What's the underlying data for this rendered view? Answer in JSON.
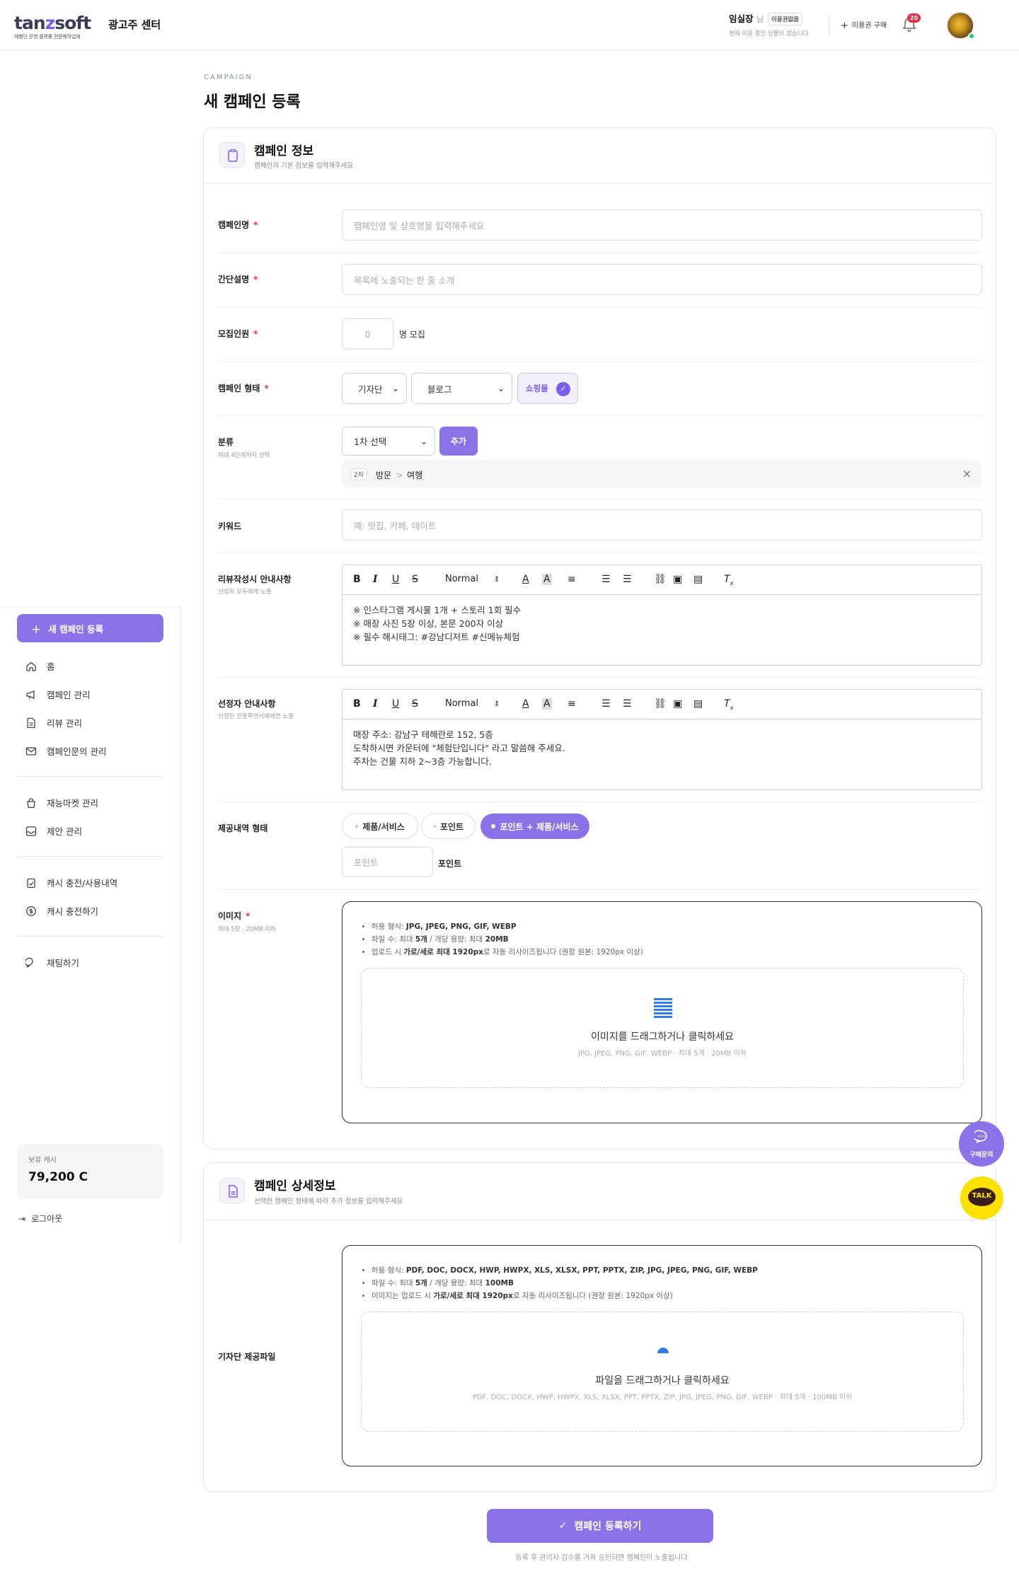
{
  "header": {
    "logo_a": "tan",
    "logo_b": "z",
    "logo_c": "soft",
    "logo_tagline": "체험단 운영 플랫폼 전문제작업체",
    "site_title": "광고주 센터",
    "user_name": "임실장",
    "user_suffix": "님",
    "user_badge": "이용권없음",
    "user_sub": "현재 이용 중인 상품이 없습니다.",
    "buy_label": "이용권 구매",
    "notif_count": "20"
  },
  "sidebar": {
    "new_campaign": "새 캠페인 등록",
    "items": [
      {
        "label": "홈",
        "icon": "home-icon"
      },
      {
        "label": "캠페인 관리",
        "icon": "megaphone-icon"
      },
      {
        "label": "리뷰 관리",
        "icon": "document-icon"
      },
      {
        "label": "캠페인문의 관리",
        "icon": "mail-icon"
      },
      {
        "label": "재능마켓 관리",
        "icon": "bag-icon"
      },
      {
        "label": "제안 관리",
        "icon": "inbox-icon"
      },
      {
        "label": "캐시 충전/사용내역",
        "icon": "clipboard-check-icon"
      },
      {
        "label": "캐시 충전하기",
        "icon": "dollar-icon"
      },
      {
        "label": "채팅하기",
        "icon": "chat-icon"
      }
    ],
    "cash_label": "보유 캐시",
    "cash_value": "79,200 C",
    "logout": "로그아웃"
  },
  "page": {
    "eyebrow": "CAMPAIGN",
    "title": "새 캠페인 등록"
  },
  "info_card": {
    "title": "캠페인 정보",
    "subtitle": "캠페인의 기본 정보를 입력해주세요",
    "name_label": "캠페인명",
    "name_placeholder": "캠페인명 및 상호명을 입력해주세요",
    "desc_label": "간단설명",
    "desc_placeholder": "목록에 노출되는 한 줄 소개",
    "recruit_label": "모집인원",
    "recruit_placeholder": "0",
    "recruit_suffix": "명 모집",
    "type_label": "캠페인 형태",
    "type_select1": "기자단",
    "type_select2": "블로그",
    "type_toggle": "쇼핑몰",
    "cat_label": "분류",
    "cat_sub": "최대 4단계까지 선택",
    "cat_select": "1차 선택",
    "cat_add": "추가",
    "cat_level": "2차",
    "cat_path_a": "방문",
    "cat_path_sep": ">",
    "cat_path_b": "여행",
    "kw_label": "키워드",
    "kw_placeholder": "예: 맛집, 카페, 데이트",
    "review_label": "리뷰작성시 안내사항",
    "review_sub": "신청자 모두에게 노출",
    "review_lines": [
      "※ 인스타그램 게시물 1개 + 스토리 1회 필수",
      "※ 매장 사진 5장 이상, 본문 200자 이상",
      "※ 필수 해시태그: #강남디저트 #신메뉴체험"
    ],
    "sel_label": "선정자 안내사항",
    "sel_sub": "선정된 인플루언서에게만 노출",
    "sel_lines": [
      "매장 주소: 강남구 테헤란로 152, 5층",
      "도착하시면 카운터에 \"체험단입니다\" 라고 말씀해 주세요.",
      "주차는 건물 지하 2~3층 가능합니다."
    ],
    "editor_size": "Normal",
    "offer_label": "제공내역 형태",
    "offer_opt1": "제품/서비스",
    "offer_opt2": "포인트",
    "offer_opt3": "포인트 + 제품/서비스",
    "point_placeholder": "포인트",
    "point_suffix": "포인트",
    "img_label": "이미지",
    "img_sub": "최대 5장 · 20MB 이하",
    "img_rule1_a": "허용 형식:",
    "img_rule1_b": "JPG, JPEG, PNG, GIF, WEBP",
    "img_rule2_a": "파일 수: 최대",
    "img_rule2_b": "5개",
    "img_rule2_c": "/ 개당 용량: 최대",
    "img_rule2_d": "20MB",
    "img_rule3_a": "업로드 시",
    "img_rule3_b": "가로/세로 최대 1920px",
    "img_rule3_c": "로 자동 리사이즈됩니다 (권장 원본: 1920px 이상)",
    "img_drop": "이미지를 드래그하거나 클릭하세요",
    "img_drop_sub": "JPG, JPEG, PNG, GIF, WEBP · 최대 5개 · 20MB 이하"
  },
  "detail_card": {
    "title": "캠페인 상세정보",
    "subtitle": "선택한 캠페인 형태에 따라 추가 정보를 입력해주세요",
    "file_label": "기자단 제공파일",
    "rule1_a": "허용 형식:",
    "rule1_b": "PDF, DOC, DOCX, HWP, HWPX, XLS, XLSX, PPT, PPTX, ZIP, JPG, JPEG, PNG, GIF, WEBP",
    "rule2_a": "파일 수: 최대",
    "rule2_b": "5개",
    "rule2_c": "/ 개당 용량: 최대",
    "rule2_d": "100MB",
    "rule3_a": "이미지는 업로드 시",
    "rule3_b": "가로/세로 최대 1920px",
    "rule3_c": "로 자동 리사이즈됩니다 (권장 원본: 1920px 이상)",
    "drop": "파일을 드래그하거나 클릭하세요",
    "drop_sub": "PDF, DOC, DOCX, HWP, HWPX, XLS, XLSX, PPT, PPTX, ZIP, JPG, JPEG, PNG, GIF, WEBP · 최대 5개 · 100MB 이하"
  },
  "footer": {
    "submit": "캠페인 등록하기",
    "note": "등록 후 관리자 검수를 거쳐 승인되면 캠페인이 노출됩니다"
  },
  "floating": {
    "inquiry": "구매문의",
    "kakao": "TALK"
  },
  "colors": {
    "accent": "#8b72e8",
    "required": "#e5304a",
    "kakao": "#fae100"
  }
}
